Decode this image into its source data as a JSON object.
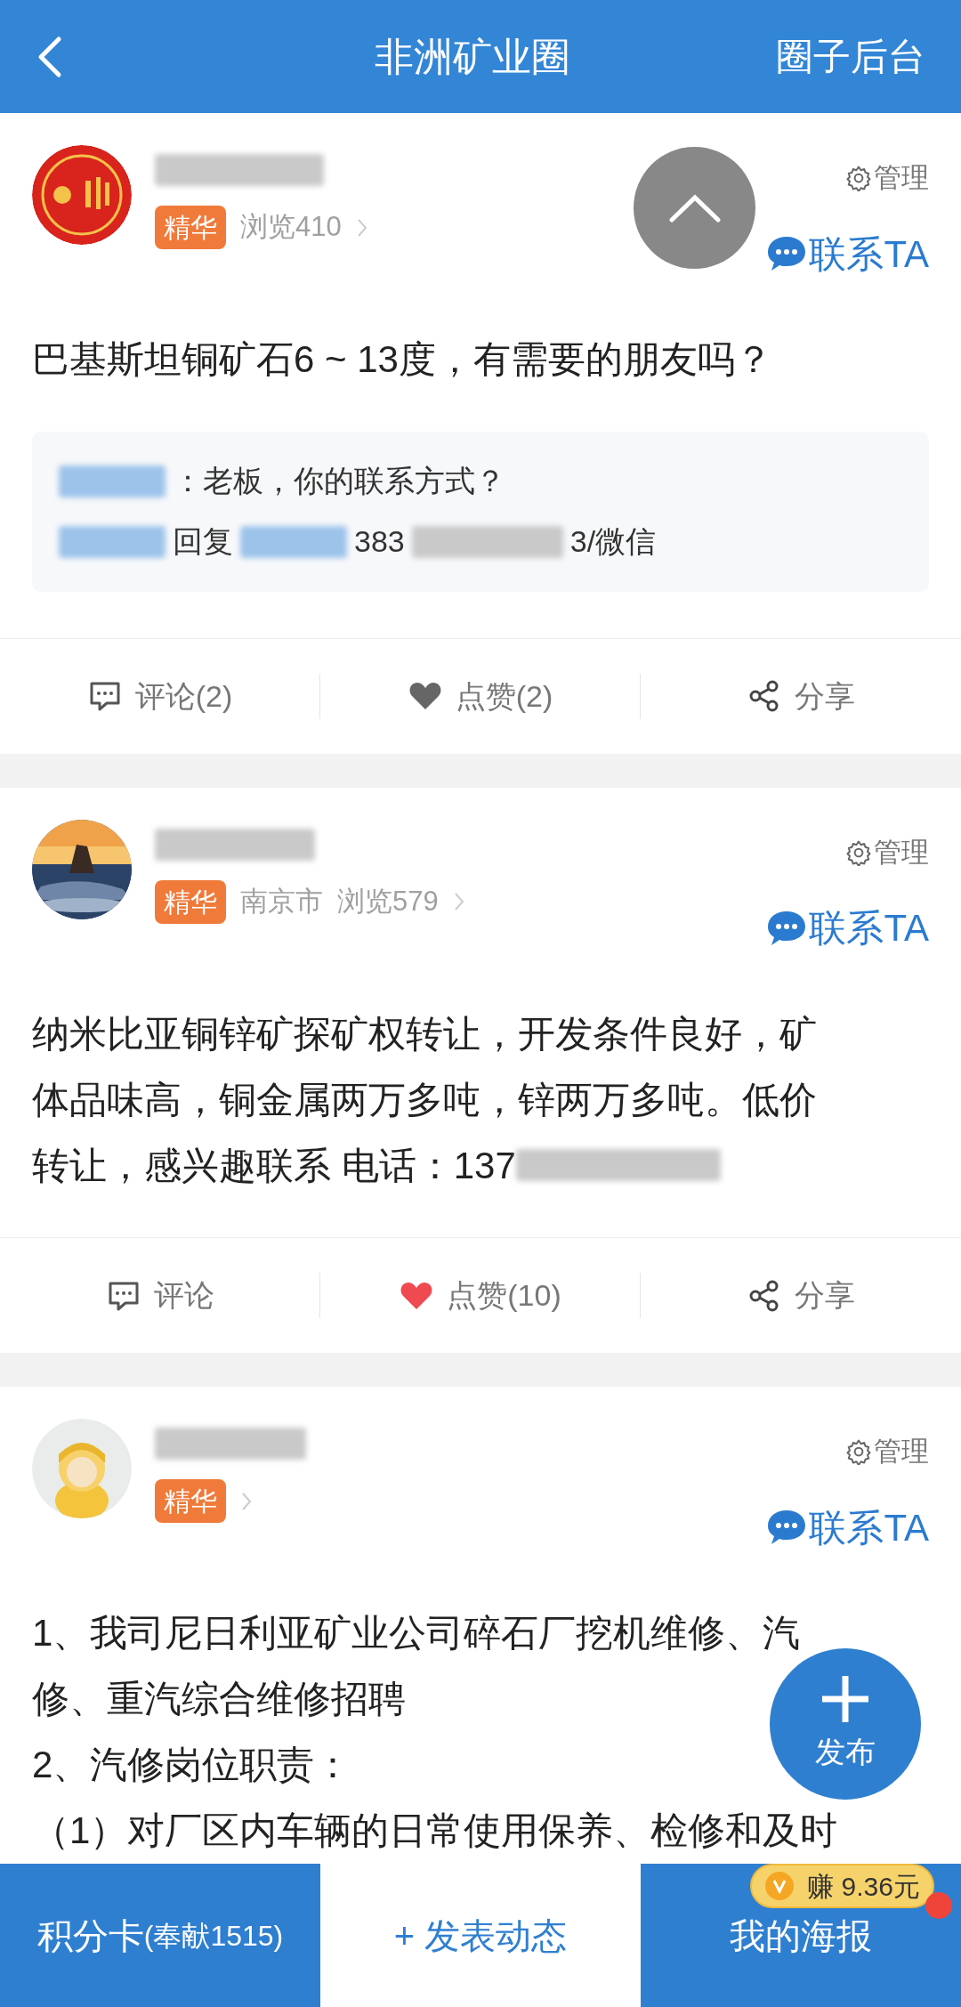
{
  "header": {
    "title": "非洲矿业圈",
    "action": "圈子后台"
  },
  "posts": [
    {
      "avatar": {
        "kind": "seal"
      },
      "badge": "精华",
      "meta": [
        "浏览410"
      ],
      "manage": "管理",
      "contact": "联系TA",
      "content": [
        {
          "text": "巴基斯坦铜矿石6 ~ 13度，有需要的朋友吗？",
          "blurred_tail": false
        }
      ],
      "comments": [
        {
          "segments": [
            {
              "kind": "name"
            },
            {
              "kind": "text",
              "text": "：老板，你的联系方式？"
            }
          ]
        },
        {
          "segments": [
            {
              "kind": "name"
            },
            {
              "kind": "text",
              "text": "回复"
            },
            {
              "kind": "name"
            },
            {
              "kind": "text",
              "text": "383"
            },
            {
              "kind": "blur"
            },
            {
              "kind": "text",
              "text": "3/微信"
            }
          ]
        }
      ],
      "actions": {
        "comment": "评论(2)",
        "like": "点赞(2)",
        "liked": false,
        "share": "分享"
      }
    },
    {
      "avatar": {
        "kind": "sunset"
      },
      "badge": "精华",
      "meta": [
        "南京市",
        "浏览579"
      ],
      "manage": "管理",
      "contact": "联系TA",
      "content": [
        {
          "text": "纳米比亚铜锌矿探矿权转让，开发条件良好，矿",
          "blurred_tail": false
        },
        {
          "text": "体品味高，铜金属两万多吨，锌两万多吨。低价",
          "blurred_tail": false
        },
        {
          "text": "转让，感兴趣联系 电话：137",
          "blurred_tail": true
        }
      ],
      "actions": {
        "comment": "评论",
        "like": "点赞(10)",
        "liked": true,
        "share": "分享"
      }
    },
    {
      "avatar": {
        "kind": "figure"
      },
      "badge": "精华",
      "manage": "管理",
      "contact": "联系TA",
      "content": [
        {
          "text": "1、我司尼日利亚矿业公司碎石厂挖机维修、汽",
          "blurred_tail": false
        },
        {
          "text": "修、重汽综合维修招聘",
          "blurred_tail": false
        },
        {
          "text": "2、汽修岗位职责：",
          "blurred_tail": false
        },
        {
          "text": "（1）对厂区内车辆的日常使用保养、检修和及时",
          "blurred_tail": false
        }
      ]
    }
  ],
  "fab": {
    "label": "发布"
  },
  "bottom_bar": [
    {
      "kind": "filled",
      "label": "积分卡",
      "note": "(奉献1515)"
    },
    {
      "kind": "plain",
      "label": "+ 发表动态"
    },
    {
      "kind": "filled",
      "label": "我的海报",
      "reward": "赚 9.36元",
      "dot": true
    }
  ]
}
